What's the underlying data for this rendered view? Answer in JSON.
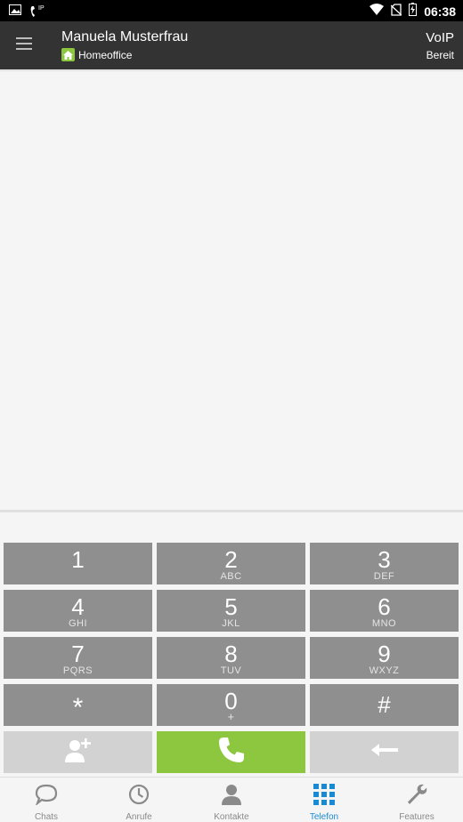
{
  "status_bar": {
    "time": "06:38",
    "call_indicator": "IP",
    "icons": [
      "image-icon",
      "phone-ip-icon",
      "wifi-icon",
      "no-sim-icon",
      "battery-icon"
    ]
  },
  "header": {
    "contact_name": "Manuela Musterfrau",
    "presence_status": "Homeoffice",
    "connection_type": "VoIP",
    "connection_status": "Bereit",
    "colors": {
      "background": "#333333",
      "presence": "#8dc63f"
    }
  },
  "dialpad": {
    "keys": [
      {
        "digit": "1",
        "letters": ""
      },
      {
        "digit": "2",
        "letters": "ABC"
      },
      {
        "digit": "3",
        "letters": "DEF"
      },
      {
        "digit": "4",
        "letters": "GHI"
      },
      {
        "digit": "5",
        "letters": "JKL"
      },
      {
        "digit": "6",
        "letters": "MNO"
      },
      {
        "digit": "7",
        "letters": "PQRS"
      },
      {
        "digit": "8",
        "letters": "TUV"
      },
      {
        "digit": "9",
        "letters": "WXYZ"
      },
      {
        "digit": "*",
        "letters": ""
      },
      {
        "digit": "0",
        "letters": "+"
      },
      {
        "digit": "#",
        "letters": ""
      }
    ],
    "actions": [
      "add-contact-icon",
      "phone-icon",
      "backspace-icon"
    ],
    "colors": {
      "key": "#8f8f8f",
      "action_key": "#d2d2d2",
      "call": "#8dc63f"
    }
  },
  "bottom_nav": {
    "items": [
      {
        "label": "Chats",
        "icon": "chat-bubble-icon"
      },
      {
        "label": "Anrufe",
        "icon": "clock-icon"
      },
      {
        "label": "Kontakte",
        "icon": "person-icon"
      },
      {
        "label": "Telefon",
        "icon": "dialpad-icon"
      },
      {
        "label": "Features",
        "icon": "wrench-icon"
      }
    ],
    "active": "Telefon",
    "colors": {
      "active": "#1a8ad4",
      "inactive": "#8a8a8a"
    }
  }
}
